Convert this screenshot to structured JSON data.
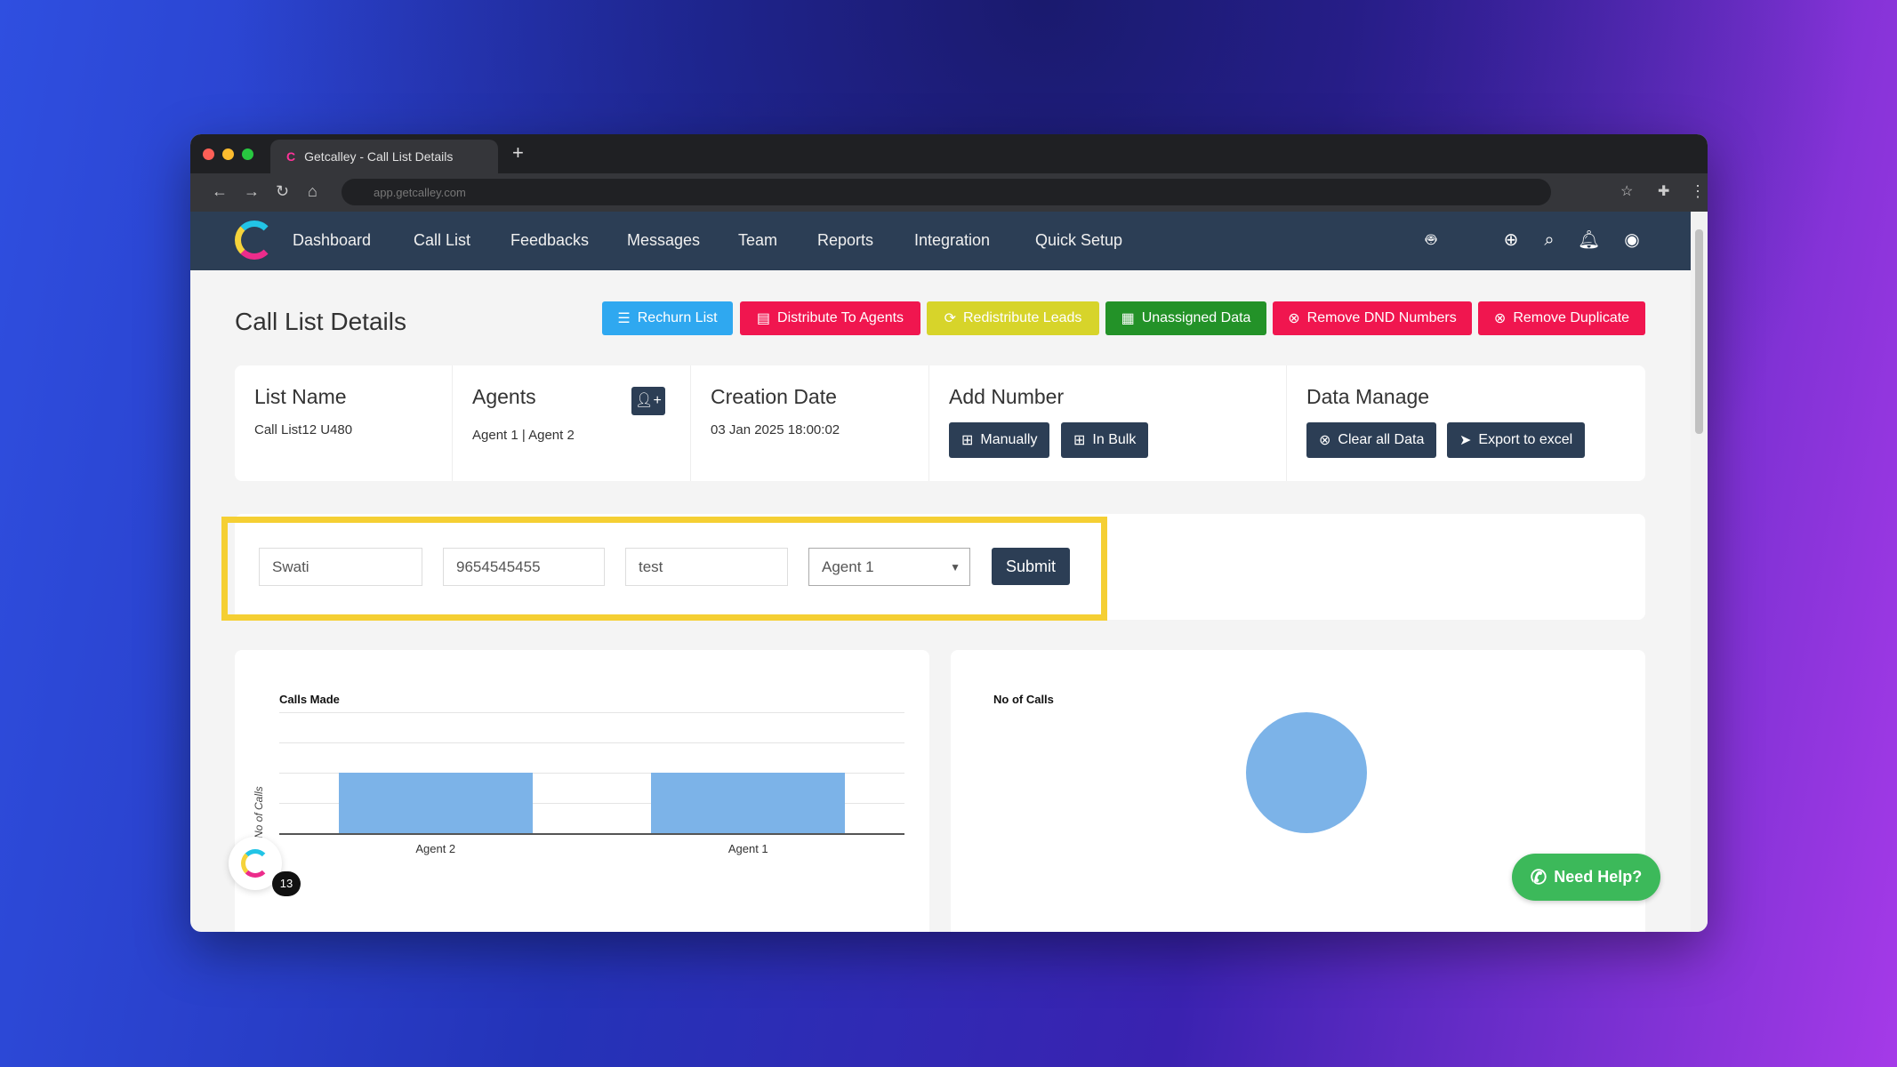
{
  "browser": {
    "tab_title": "Getcalley - Call List Details",
    "url": "app.getcalley.com"
  },
  "nav": {
    "items": [
      "Dashboard",
      "Call List",
      "Feedbacks",
      "Messages",
      "Team",
      "Reports",
      "Integration",
      "Quick Setup"
    ],
    "right_icons": [
      "android-icon",
      "apple-icon",
      "support-icon",
      "search-icon",
      "bell-icon",
      "user-icon"
    ]
  },
  "page": {
    "title": "Call List Details"
  },
  "actions": [
    {
      "label": "Rechurn List",
      "color": "#2fa8f0",
      "icon": "list-icon"
    },
    {
      "label": "Distribute To Agents",
      "color": "#f0164f",
      "icon": "database-icon"
    },
    {
      "label": "Redistribute Leads",
      "color": "#d7d42a",
      "icon": "refresh-icon"
    },
    {
      "label": "Unassigned Data",
      "color": "#239228",
      "icon": "table-icon"
    },
    {
      "label": "Remove DND Numbers",
      "color": "#f0164f",
      "icon": "remove-circle-icon"
    },
    {
      "label": "Remove Duplicate",
      "color": "#f0164f",
      "icon": "remove-circle-icon"
    }
  ],
  "info": {
    "list_name": {
      "label": "List Name",
      "value": "Call List12 U480"
    },
    "agents": {
      "label": "Agents",
      "value": "Agent 1 | Agent 2"
    },
    "creation": {
      "label": "Creation Date",
      "value": "03 Jan 2025 18:00:02"
    },
    "add_number": {
      "label": "Add Number",
      "manually": "Manually",
      "bulk": "In Bulk"
    },
    "data_manage": {
      "label": "Data Manage",
      "clear": "Clear all Data",
      "export": "Export to excel"
    }
  },
  "form": {
    "name": "Swati",
    "phone": "9654545455",
    "note": "test",
    "agent": "Agent 1",
    "submit": "Submit"
  },
  "chart_data": [
    {
      "type": "bar",
      "title": "Calls Made",
      "ylabel": "No of Calls",
      "categories": [
        "Agent 2",
        "Agent 1"
      ],
      "values": [
        1,
        1
      ],
      "ylim": [
        0,
        2
      ],
      "grid": true,
      "color": "#7cb3e8"
    },
    {
      "type": "pie",
      "title": "No of Calls",
      "values": [
        1
      ],
      "color": "#7cb3e8"
    }
  ],
  "widget": {
    "badge": "13"
  },
  "help": {
    "label": "Need Help?",
    "color": "#3cb95a"
  }
}
